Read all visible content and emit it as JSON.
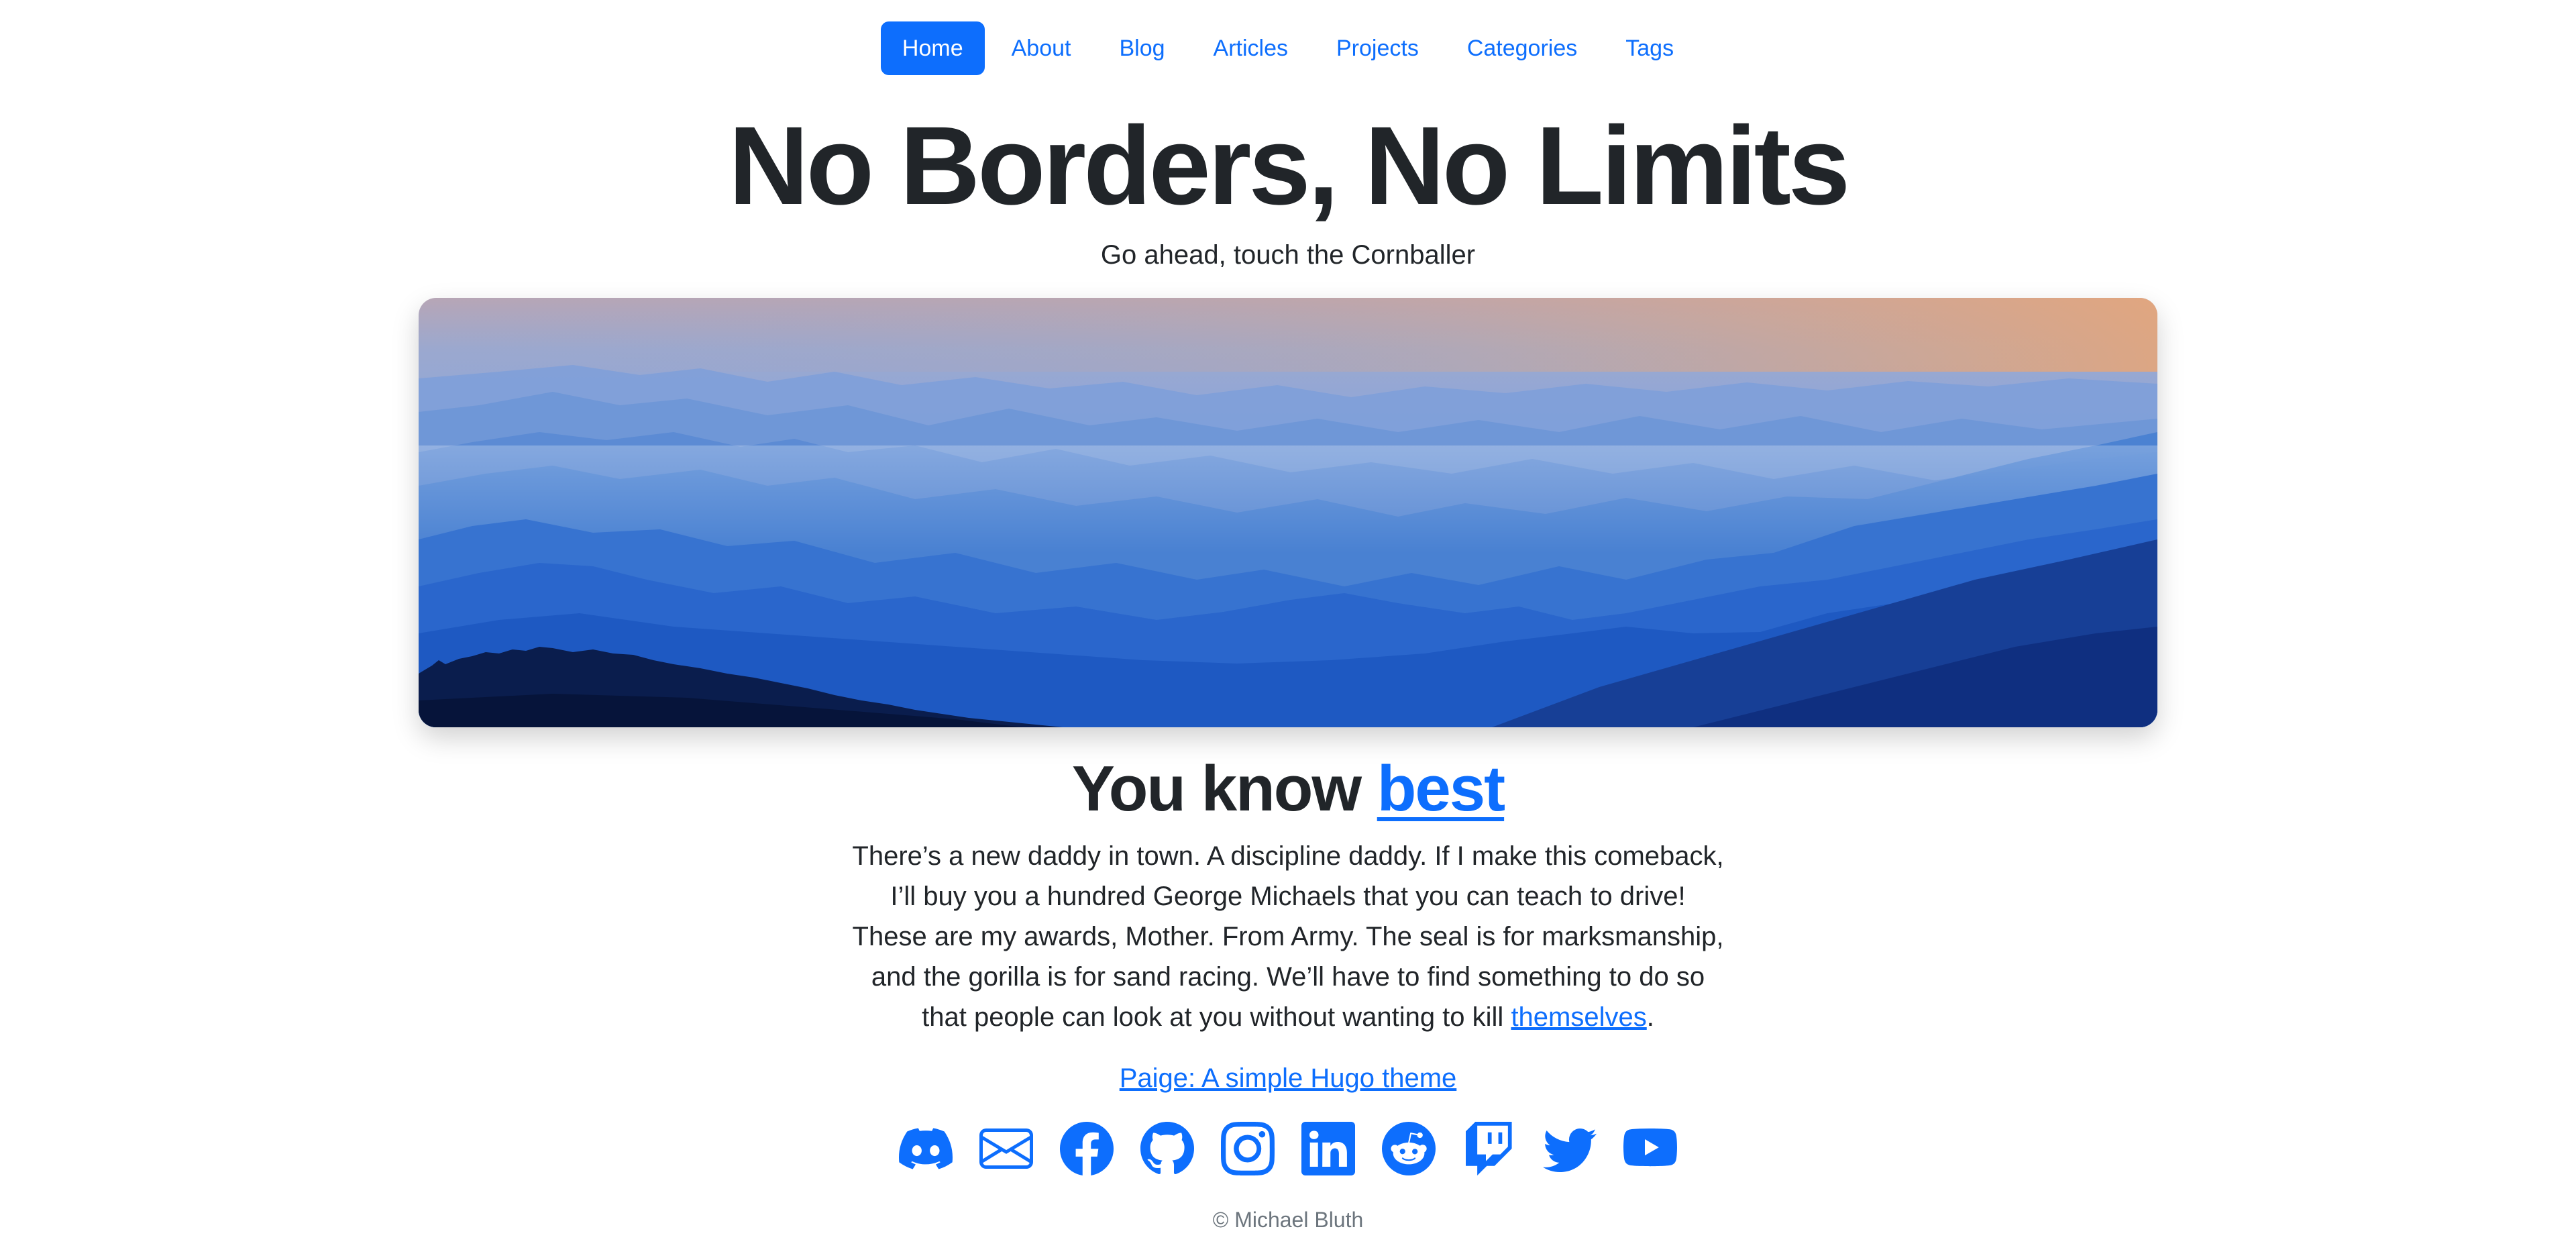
{
  "nav": {
    "items": [
      {
        "label": "Home",
        "active": true
      },
      {
        "label": "About"
      },
      {
        "label": "Blog"
      },
      {
        "label": "Articles"
      },
      {
        "label": "Projects"
      },
      {
        "label": "Categories"
      },
      {
        "label": "Tags"
      }
    ]
  },
  "site": {
    "title": "No Borders, No Limits",
    "subtitle": "Go ahead, touch the Cornballer"
  },
  "hero": {
    "alt": "Layered blue mountain ridges at sunset"
  },
  "content": {
    "heading_prefix": "You know ",
    "heading_link": "best",
    "paragraph_text": "There’s a new daddy in town. A discipline daddy. If I make this comeback, I’ll buy you a hundred George Michaels that you can teach to drive! These are my awards, Mother. From Army. The seal is for marksmanship, and the gorilla is for sand racing. We’ll have to find something to do so that people can look at you without wanting to kill ",
    "paragraph_link": "themselves",
    "paragraph_end": "."
  },
  "theme_link": "Paige: A simple Hugo theme",
  "social": [
    {
      "icon": "discord-icon"
    },
    {
      "icon": "email-icon"
    },
    {
      "icon": "facebook-icon"
    },
    {
      "icon": "github-icon"
    },
    {
      "icon": "instagram-icon"
    },
    {
      "icon": "linkedin-icon"
    },
    {
      "icon": "reddit-icon"
    },
    {
      "icon": "twitch-icon"
    },
    {
      "icon": "twitter-icon"
    },
    {
      "icon": "youtube-icon"
    }
  ],
  "footer": {
    "copyright": "© Michael Bluth"
  },
  "colors": {
    "accent": "#0d6efd",
    "text": "#212529",
    "muted": "#6c757d"
  }
}
